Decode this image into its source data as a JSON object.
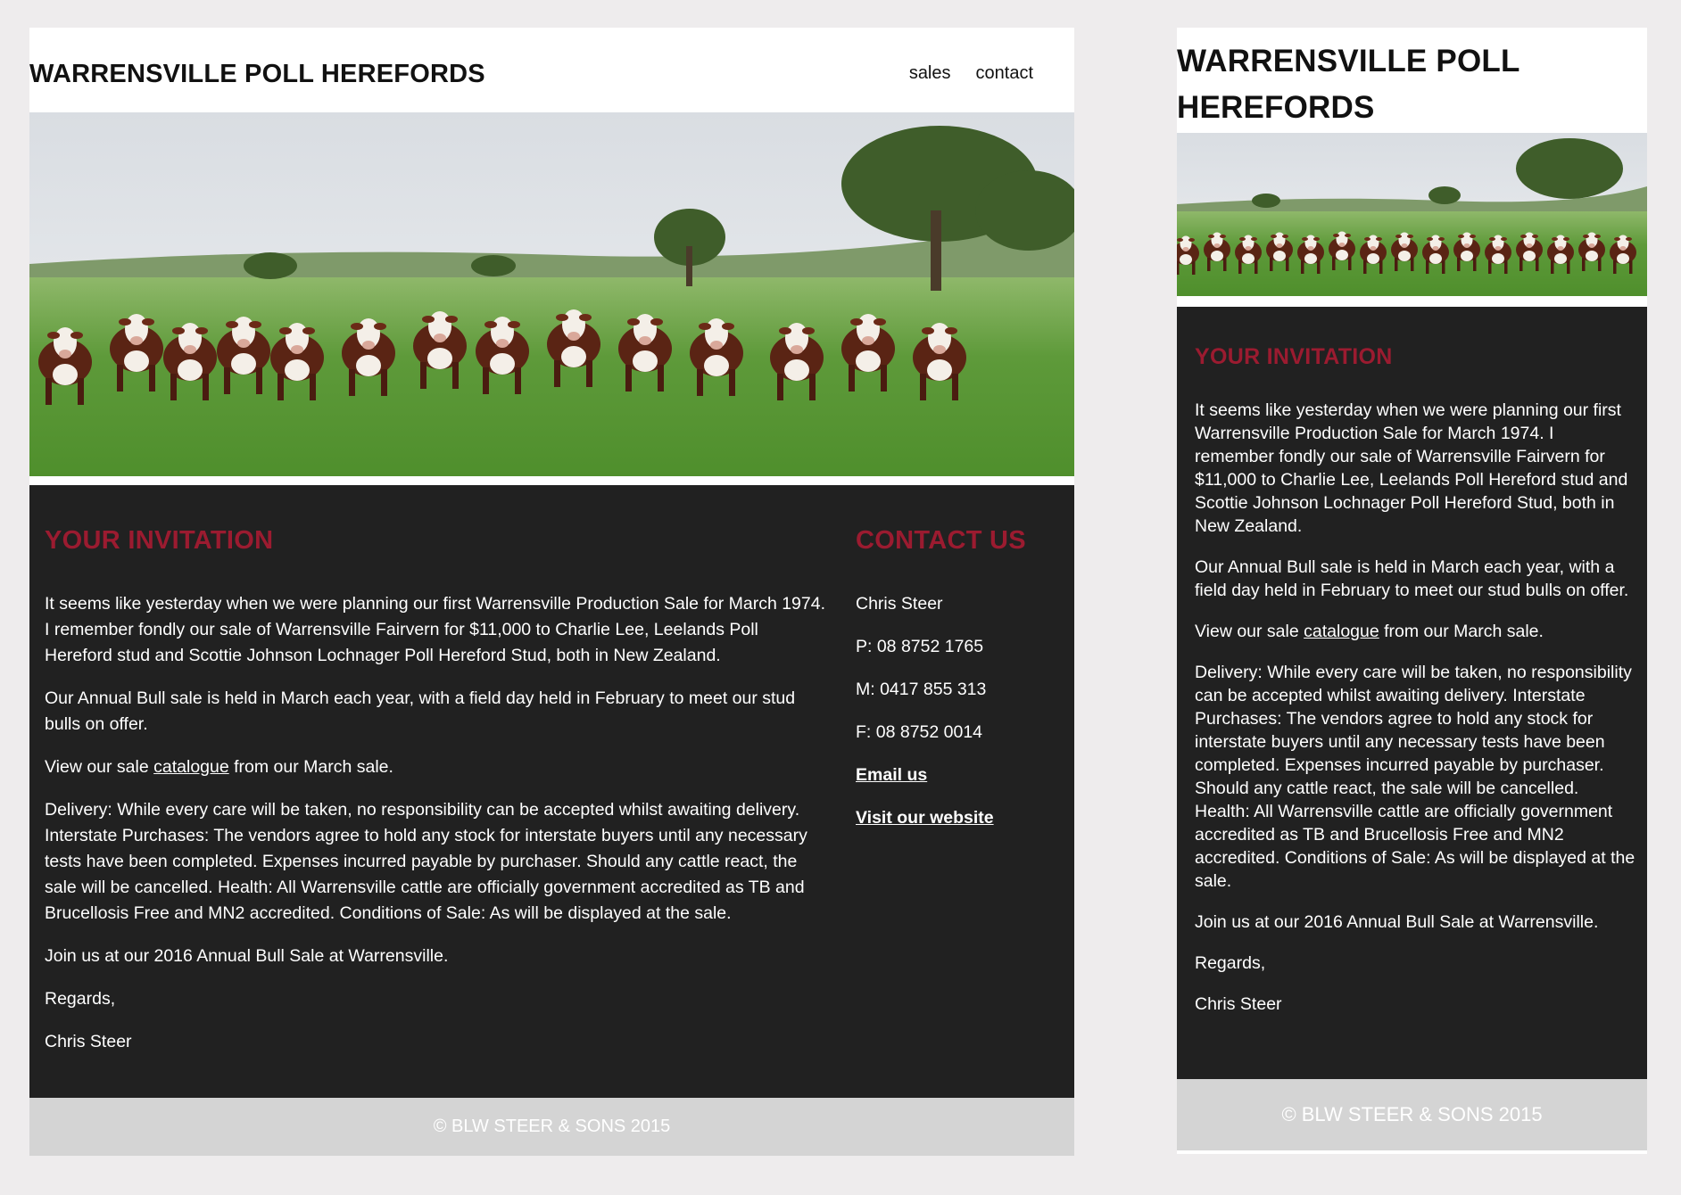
{
  "site": {
    "title": "WARRENSVILLE POLL HEREFORDS"
  },
  "nav": {
    "items": [
      {
        "label": "sales"
      },
      {
        "label": "contact"
      }
    ]
  },
  "hero": {
    "image": "hereford-cattle-paddock-photo"
  },
  "invitation": {
    "heading": "YOUR INVITATION",
    "p1": "It seems like yesterday when we were planning our first Warrensville Production Sale for March 1974. I remember fondly our sale of Warrensville Fairvern for $11,000 to Charlie Lee, Leelands Poll Hereford stud and Scottie Johnson Lochnager Poll Hereford Stud, both in New Zealand.",
    "p2": "Our Annual Bull sale is held in March each year, with a field day held in February to meet our stud bulls on offer.",
    "p3_prefix": "View our sale ",
    "p3_link": "catalogue",
    "p3_suffix": " from our March sale.",
    "p4": "Delivery: While every care will be taken, no responsibility can be accepted whilst awaiting delivery. Interstate Purchases: The vendors agree to hold any stock for interstate buyers until any necessary tests have been completed. Expenses incurred payable by purchaser. Should any cattle react, the sale will be cancelled. Health: All Warrensville cattle are officially government accredited as TB and Brucellosis Free and MN2 accredited. Conditions of Sale: As will be displayed at the sale.",
    "p5": "Join us at our 2016 Annual Bull Sale at Warrensville.",
    "p6": "Regards,",
    "p7": "Chris Steer"
  },
  "contact": {
    "heading": "CONTACT US",
    "name": "Chris Steer",
    "phone": "P: 08 8752 1765",
    "mobile": "M: 0417 855 313",
    "fax": "F: 08 8752 0014",
    "email_link": "Email us",
    "website_link": "Visit our website"
  },
  "footer": {
    "text": "© BLW STEER & SONS 2015"
  },
  "colors": {
    "background": "#eeeced",
    "accent": "#9b1b30",
    "content_bg": "#212121",
    "footer_bg": "#d4d4d4"
  }
}
